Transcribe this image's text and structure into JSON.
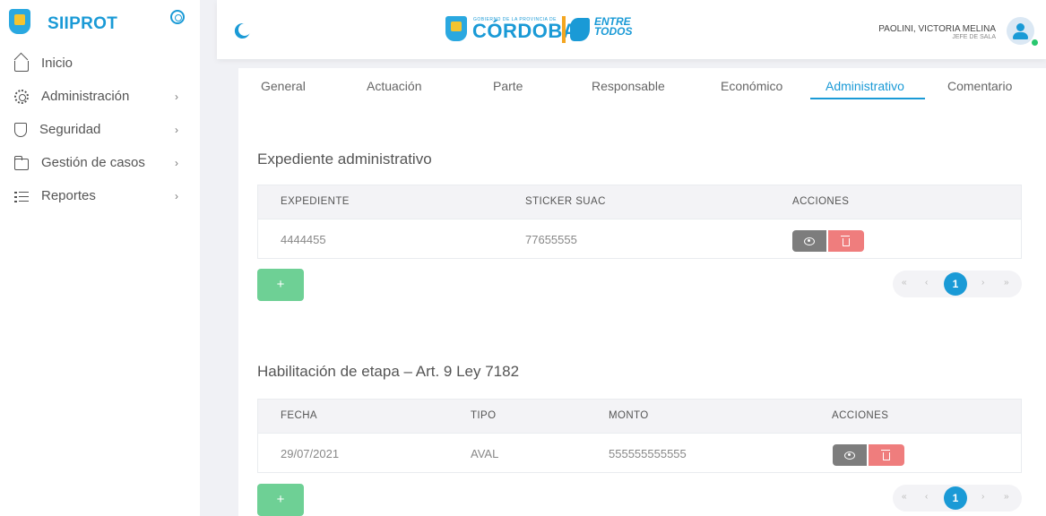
{
  "sidebar": {
    "brand": "SIIPROT",
    "items": [
      {
        "label": "Inicio",
        "icon": "home-icon",
        "has_children": false
      },
      {
        "label": "Administración",
        "icon": "gear-icon",
        "has_children": true
      },
      {
        "label": "Seguridad",
        "icon": "shield-icon",
        "has_children": true
      },
      {
        "label": "Gestión de casos",
        "icon": "folder-icon",
        "has_children": true
      },
      {
        "label": "Reportes",
        "icon": "list-icon",
        "has_children": true
      }
    ],
    "chevron": "›"
  },
  "header": {
    "gov_small": "GOBIERNO DE LA PROVINCIA DE",
    "gov_name": "CÓRDOBA",
    "gov_motto": "ENTRE TODOS",
    "user_name": "PAOLINI, VICTORIA MELINA",
    "user_role": "JEFE DE SALA"
  },
  "tabs": [
    "General",
    "Actuación",
    "Parte",
    "Responsable",
    "Económico",
    "Administrativo",
    "Comentario"
  ],
  "active_tab": "Administrativo",
  "expediente": {
    "title": "Expediente administrativo",
    "columns": [
      "EXPEDIENTE",
      "STICKER SUAC",
      "ACCIONES"
    ],
    "rows": [
      {
        "expediente": "4444455",
        "sticker": "77655555"
      }
    ],
    "add_label": "+",
    "pager": {
      "first": "«",
      "prev": "‹",
      "current": "1",
      "next": "›",
      "last": "»"
    }
  },
  "habilitacion": {
    "title": "Habilitación de etapa – Art. 9 Ley 7182",
    "columns": [
      "FECHA",
      "TIPO",
      "MONTO",
      "ACCIONES"
    ],
    "rows": [
      {
        "fecha": "29/07/2021",
        "tipo": "AVAL",
        "monto": "555555555555"
      }
    ],
    "add_label": "+",
    "pager": {
      "first": "«",
      "prev": "‹",
      "current": "1",
      "next": "›",
      "last": "»"
    }
  },
  "colors": {
    "accent": "#1a9ad6",
    "success": "#5fcc8a",
    "danger": "#ef7d7d",
    "secondary": "#7d7d7d"
  }
}
